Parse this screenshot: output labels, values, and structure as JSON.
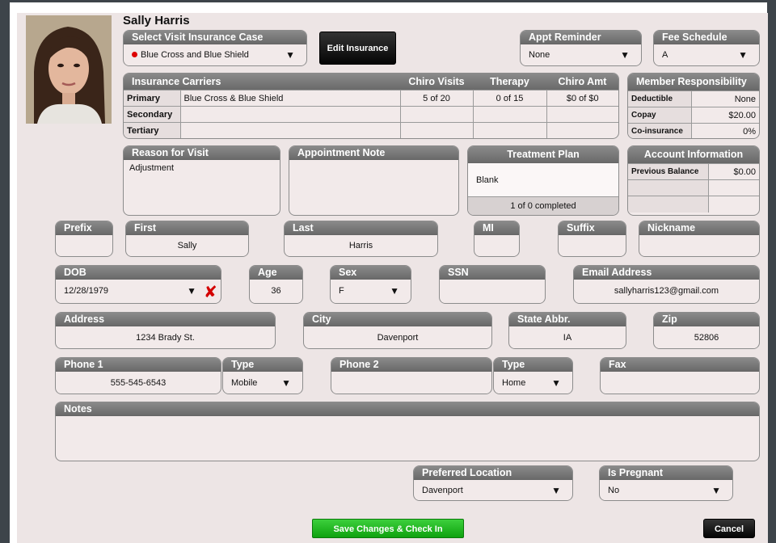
{
  "patient": {
    "name": "Sally Harris"
  },
  "insurance_case": {
    "label": "Select Visit Insurance Case",
    "value": "Blue Cross and Blue Shield"
  },
  "edit_insurance_label": "Edit Insurance",
  "appt_reminder": {
    "label": "Appt Reminder",
    "value": "None"
  },
  "fee_schedule": {
    "label": "Fee Schedule",
    "value": "A"
  },
  "carriers": {
    "headers": [
      "Insurance Carriers",
      "Chiro Visits",
      "Therapy",
      "Chiro Amt"
    ],
    "rows": [
      {
        "label": "Primary",
        "carrier": "Blue Cross & Blue Shield",
        "chiro_visits": "5 of 20",
        "therapy": "0 of 15",
        "chiro_amt": "$0 of $0"
      },
      {
        "label": "Secondary",
        "carrier": "",
        "chiro_visits": "",
        "therapy": "",
        "chiro_amt": ""
      },
      {
        "label": "Tertiary",
        "carrier": "",
        "chiro_visits": "",
        "therapy": "",
        "chiro_amt": ""
      }
    ]
  },
  "member_resp": {
    "label": "Member Responsibility",
    "rows": [
      {
        "label": "Deductible",
        "value": "None"
      },
      {
        "label": "Copay",
        "value": "$20.00"
      },
      {
        "label": "Co-insurance",
        "value": "0%"
      }
    ]
  },
  "reason": {
    "label": "Reason for Visit",
    "value": "Adjustment"
  },
  "appt_note": {
    "label": "Appointment Note",
    "value": ""
  },
  "treatment": {
    "label": "Treatment Plan",
    "value": "Blank",
    "status": "1 of 0 completed"
  },
  "account": {
    "label": "Account Information",
    "rows": [
      {
        "label": "Previous Balance",
        "value": "$0.00"
      }
    ]
  },
  "fields": {
    "prefix": {
      "label": "Prefix",
      "value": ""
    },
    "first": {
      "label": "First",
      "value": "Sally"
    },
    "last": {
      "label": "Last",
      "value": "Harris"
    },
    "mi": {
      "label": "MI",
      "value": ""
    },
    "suffix": {
      "label": "Suffix",
      "value": ""
    },
    "nickname": {
      "label": "Nickname",
      "value": ""
    },
    "dob": {
      "label": "DOB",
      "value": "12/28/1979"
    },
    "age": {
      "label": "Age",
      "value": "36"
    },
    "sex": {
      "label": "Sex",
      "value": "F"
    },
    "ssn": {
      "label": "SSN",
      "value": ""
    },
    "email": {
      "label": "Email Address",
      "value": "sallyharris123@gmail.com"
    },
    "address": {
      "label": "Address",
      "value": "1234 Brady St."
    },
    "city": {
      "label": "City",
      "value": "Davenport"
    },
    "state": {
      "label": "State Abbr.",
      "value": "IA"
    },
    "zip": {
      "label": "Zip",
      "value": "52806"
    },
    "phone1": {
      "label": "Phone 1",
      "value": "555-545-6543"
    },
    "type1": {
      "label": "Type",
      "value": "Mobile"
    },
    "phone2": {
      "label": "Phone 2",
      "value": ""
    },
    "type2": {
      "label": "Type",
      "value": "Home"
    },
    "fax": {
      "label": "Fax",
      "value": ""
    },
    "notes": {
      "label": "Notes",
      "value": ""
    },
    "location": {
      "label": "Preferred Location",
      "value": "Davenport"
    },
    "pregnant": {
      "label": "Is Pregnant",
      "value": "No"
    }
  },
  "buttons": {
    "save": "Save Changes & Check In",
    "cancel": "Cancel"
  },
  "icons": {
    "dropdown": "chevron-down-icon",
    "clear": "clear-x-icon"
  }
}
